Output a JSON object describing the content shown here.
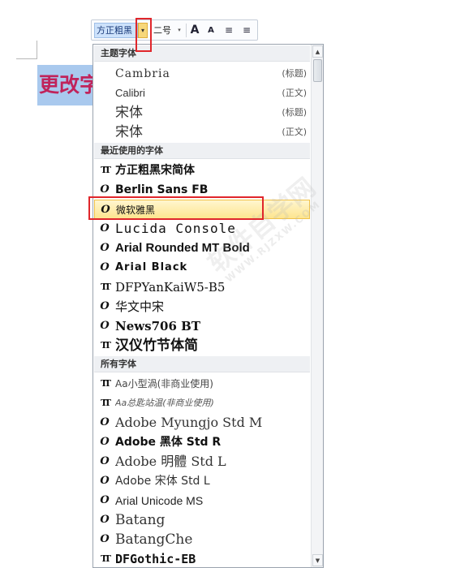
{
  "document": {
    "text": "更改字"
  },
  "toolbar": {
    "font_name": "方正粗黑",
    "dropdown_arrow": "▾",
    "font_size": "二号",
    "size_arrow": "▾",
    "grow_font_icon": "A",
    "shrink_font_icon": "A",
    "decrease_indent_icon": "≡",
    "increase_indent_icon": "≡"
  },
  "dropdown": {
    "sections": [
      {
        "label": "主题字体"
      },
      {
        "label": "最近使用的字体"
      },
      {
        "label": "所有字体"
      }
    ],
    "theme_fonts": [
      {
        "name": "Cambria",
        "tag": "(标题)"
      },
      {
        "name": "Calibri",
        "tag": "(正文)"
      },
      {
        "name": "宋体",
        "tag": "(标题)"
      },
      {
        "name": "宋体",
        "tag": "(正文)"
      }
    ],
    "recent_fonts": [
      {
        "name": "方正粗黑宋简体",
        "icon": "tt-icon"
      },
      {
        "name": "Berlin Sans FB",
        "icon": "opentype-icon"
      },
      {
        "name": "微软雅黑",
        "icon": "opentype-icon",
        "selected": true
      },
      {
        "name": "Lucida Console",
        "icon": "opentype-icon"
      },
      {
        "name": "Arial Rounded MT Bold",
        "icon": "opentype-icon"
      },
      {
        "name": "Arial Black",
        "icon": "opentype-icon"
      },
      {
        "name": "DFPYanKaiW5-B5",
        "icon": "tt-icon"
      },
      {
        "name": "华文中宋",
        "icon": "opentype-icon"
      },
      {
        "name": "News706 BT",
        "icon": "opentype-icon"
      },
      {
        "name": "汉仪竹节体简",
        "icon": "tt-icon"
      }
    ],
    "all_fonts": [
      {
        "name": "Aa小型渦(非商业使用)",
        "icon": "tt-icon"
      },
      {
        "name": "Aa总匙站温(非商业使用)",
        "icon": "tt-icon"
      },
      {
        "name": "Adobe Myungjo Std M",
        "icon": "opentype-icon"
      },
      {
        "name": "Adobe 黑体 Std R",
        "icon": "opentype-icon"
      },
      {
        "name": "Adobe 明體 Std L",
        "icon": "opentype-icon"
      },
      {
        "name": "Adobe 宋体 Std L",
        "icon": "opentype-icon"
      },
      {
        "name": "Arial Unicode MS",
        "icon": "opentype-icon"
      },
      {
        "name": "Batang",
        "icon": "opentype-icon"
      },
      {
        "name": "BatangChe",
        "icon": "opentype-icon"
      },
      {
        "name": "DFGothic-EB",
        "icon": "tt-icon"
      }
    ],
    "scroll_up": "▲",
    "scroll_down": "▼"
  },
  "icon_glyphs": {
    "opentype-icon": "O",
    "tt-icon": "TT"
  },
  "watermark": {
    "main": "软件自学网",
    "sub": "WWW.RJZXW.COM"
  },
  "colors": {
    "highlight_bg": "#fde58f",
    "selection_border": "#e0262b",
    "doc_text": "#c0235b",
    "doc_selection": "#a9c9ee"
  }
}
